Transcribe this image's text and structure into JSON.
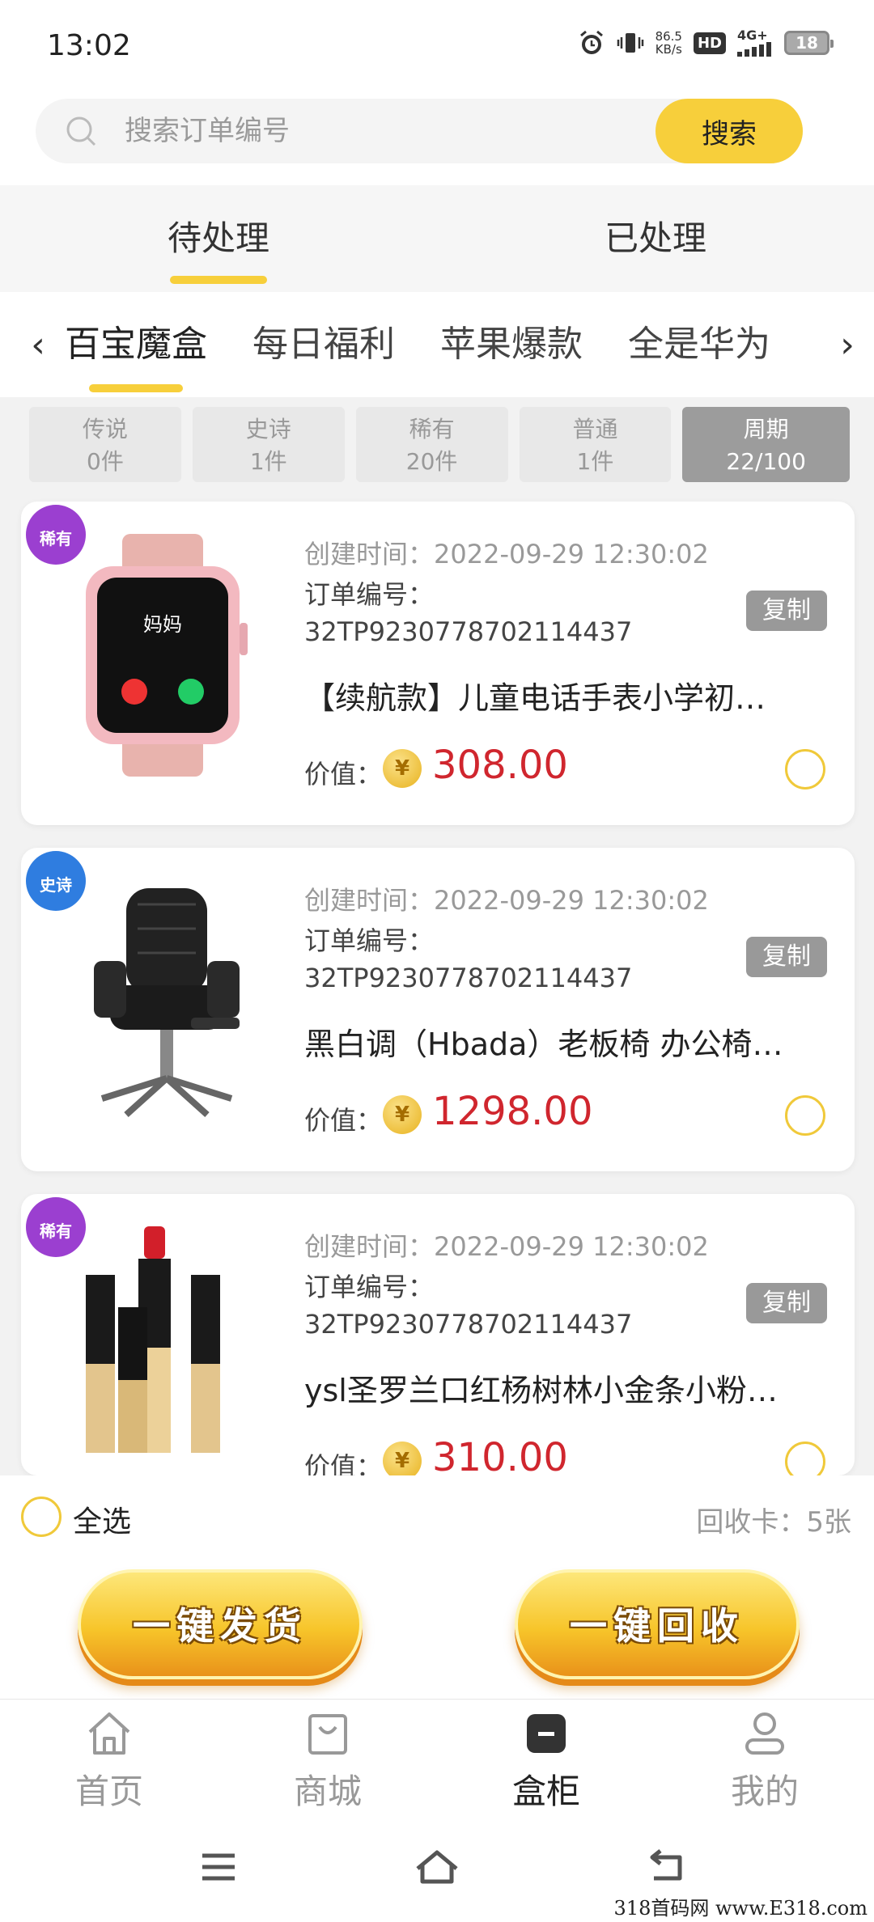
{
  "status_bar": {
    "time": "13:02",
    "speed_value": "86.5",
    "speed_unit": "KB/s",
    "hd": "HD",
    "network": "4G+",
    "battery": "18"
  },
  "search": {
    "placeholder": "搜索订单编号",
    "button_label": "搜索"
  },
  "main_tabs": [
    {
      "label": "待处理",
      "active": true
    },
    {
      "label": "已处理",
      "active": false
    }
  ],
  "categories": {
    "prev_arrow": "‹",
    "next_arrow": "›",
    "items": [
      {
        "label": "百宝魔盒",
        "active": true
      },
      {
        "label": "每日福利",
        "active": false
      },
      {
        "label": "苹果爆款",
        "active": false
      },
      {
        "label": "全是华为",
        "active": false
      }
    ]
  },
  "rarity_filters": [
    {
      "name": "传说",
      "count": "0件",
      "active": false
    },
    {
      "name": "史诗",
      "count": "1件",
      "active": false
    },
    {
      "name": "稀有",
      "count": "20件",
      "active": false
    },
    {
      "name": "普通",
      "count": "1件",
      "active": false
    },
    {
      "name": "周期",
      "count": "22/100",
      "active": true
    }
  ],
  "orders": [
    {
      "badge": "稀有",
      "badge_color": "#9b3fd0",
      "created": "创建时间：2022-09-29 12:30:02",
      "order_label": "订单编号：",
      "order_no": "32TP9230778702114437",
      "copy_label": "复制",
      "title": "【续航款】儿童电话手表小学初…",
      "value_label": "价值：",
      "coin_symbol": "¥",
      "price": "308.00",
      "watch_screen_text": "妈妈"
    },
    {
      "badge": "史诗",
      "badge_color": "#2f7de0",
      "created": "创建时间：2022-09-29 12:30:02",
      "order_label": "订单编号：",
      "order_no": "32TP9230778702114437",
      "copy_label": "复制",
      "title": "黑白调（Hbada）老板椅 办公椅…",
      "value_label": "价值：",
      "coin_symbol": "¥",
      "price": "1298.00"
    },
    {
      "badge": "稀有",
      "badge_color": "#9b3fd0",
      "created": "创建时间：2022-09-29 12:30:02",
      "order_label": "订单编号：",
      "order_no": "32TP9230778702114437",
      "copy_label": "复制",
      "title": "ysl圣罗兰口红杨树林小金条小粉…",
      "value_label": "价值：",
      "coin_symbol": "¥",
      "price": "310.00"
    }
  ],
  "select_all": {
    "label": "全选",
    "recycle_cards": "回收卡：5张"
  },
  "actions": {
    "ship_label": "一键发货",
    "recycle_label": "一键回收"
  },
  "bottom_nav": [
    {
      "label": "首页",
      "icon": "home-icon",
      "active": false
    },
    {
      "label": "商城",
      "icon": "bag-icon",
      "active": false
    },
    {
      "label": "盒柜",
      "icon": "box-icon",
      "active": true
    },
    {
      "label": "我的",
      "icon": "user-icon",
      "active": false
    }
  ],
  "colors": {
    "accent": "#f7cf3b",
    "price": "#d0262e"
  },
  "watermark": "318首码网 www.E318.com"
}
